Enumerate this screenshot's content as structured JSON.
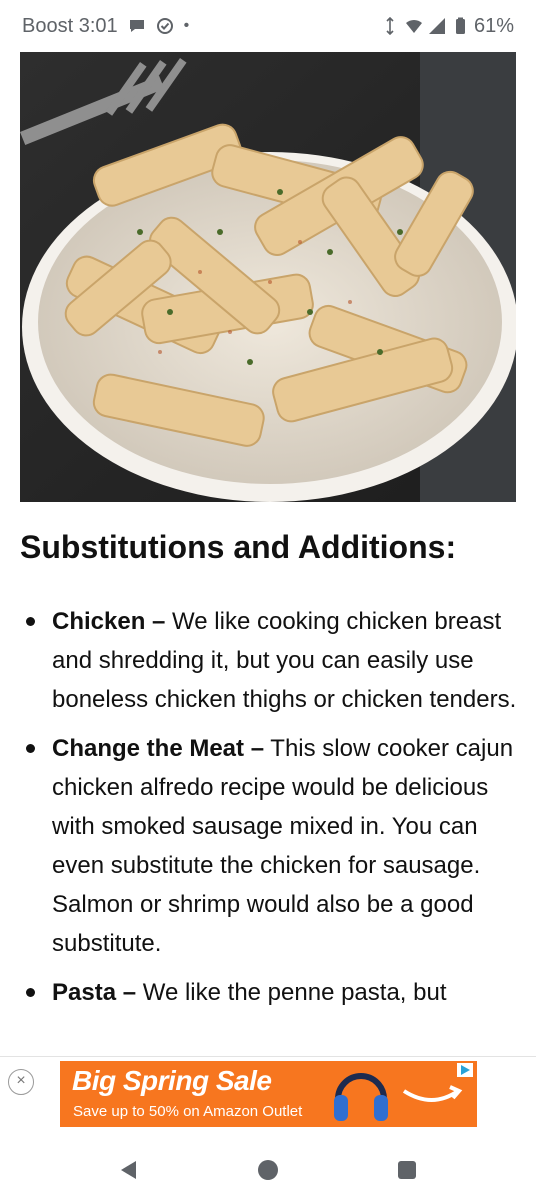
{
  "status_bar": {
    "carrier_time": "Boost 3:01",
    "dot": "•",
    "battery": "61%",
    "icons": [
      "chat-bubble-icon",
      "check-circle-icon",
      "vibrate-icon",
      "wifi-icon",
      "signal-icon",
      "battery-icon"
    ]
  },
  "hero_image": {
    "subject": "creamy penne pasta in a white bowl with a fork"
  },
  "article": {
    "heading": "Substitutions and Additions:",
    "items": [
      {
        "term": "Chicken –",
        "text": " We like cooking chicken breast and shredding it, but you can easily use boneless chicken thighs or chicken tenders."
      },
      {
        "term": "Change the Meat –",
        "text": " This slow cooker cajun chicken alfredo recipe would be delicious with smoked sausage mixed in. You can even substitute the chicken for sausage. Salmon or shrimp would also be a good substitute."
      },
      {
        "term": "Pasta –",
        "text": " We like the penne pasta, but"
      }
    ]
  },
  "ad": {
    "close": "×",
    "title": "Big Spring Sale",
    "subtitle": "Save up to 50% on Amazon Outlet",
    "accent_color": "#f7761f"
  },
  "nav_bar": {
    "icons": [
      "back-icon",
      "home-icon",
      "recents-icon"
    ]
  }
}
